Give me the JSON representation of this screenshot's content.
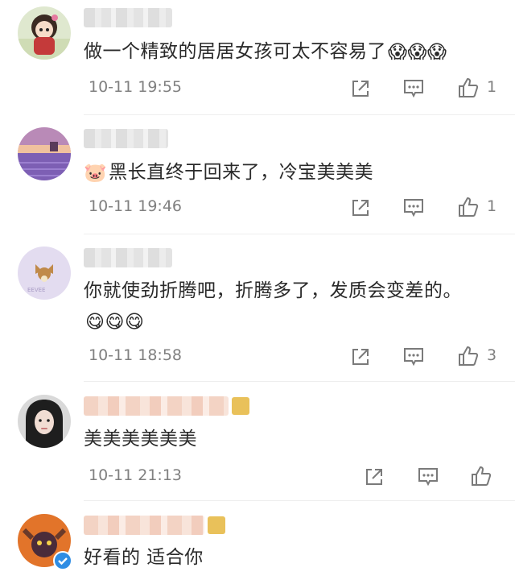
{
  "comments": [
    {
      "text": "做一个精致的居居女孩可太不容易了",
      "emoji": "😱😱😱",
      "time": "10-11 19:55",
      "likes": "1"
    },
    {
      "text": "黑长直终于回来了，冷宝美美美",
      "emoji_prefix": "🐷",
      "time": "10-11 19:46",
      "likes": "1"
    },
    {
      "text": "你就使劲折腾吧，折腾多了，发质会变差的。",
      "emoji": "😋😋😋",
      "time": "10-11 18:58",
      "likes": "3"
    },
    {
      "text": "美美美美美美",
      "time": "10-11 21:13",
      "likes": ""
    },
    {
      "text": "好看的 适合你"
    }
  ],
  "icons": {
    "share": "share-icon",
    "comment": "comment-icon",
    "like": "thumbs-up-icon",
    "verified": "verified-badge-icon"
  },
  "colors": {
    "meta_text": "#808080",
    "icon_gray": "#7a7a7a",
    "verified_blue": "#2f8de4"
  }
}
